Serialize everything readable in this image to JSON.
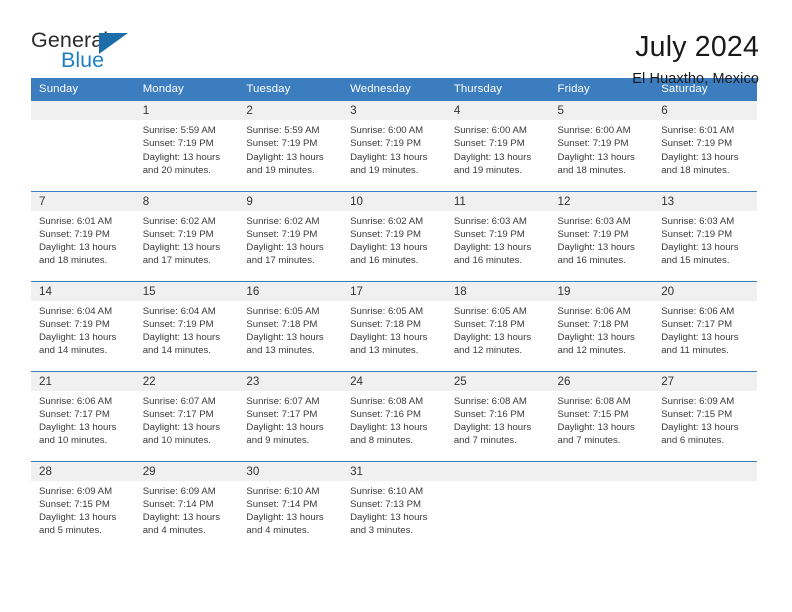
{
  "brand": {
    "word_one": "General",
    "word_two": "Blue",
    "flag_icon": "triangle-flag-icon"
  },
  "header": {
    "title": "July 2024",
    "subtitle": "El Huaxtho, Mexico"
  },
  "colors": {
    "header_blue": "#3b7dbf",
    "brand_blue": "#1f7fc4",
    "flag_blue": "#1b6ea8",
    "daynum_band": "#f0f0f0",
    "text": "#1a1a1a"
  },
  "calendar": {
    "weekdays": [
      "Sunday",
      "Monday",
      "Tuesday",
      "Wednesday",
      "Thursday",
      "Friday",
      "Saturday"
    ],
    "weeks": [
      [
        {
          "day": "",
          "blank": true,
          "sunrise": "",
          "sunset": "",
          "daylight_1": "",
          "daylight_2": ""
        },
        {
          "day": "1",
          "sunrise": "Sunrise: 5:59 AM",
          "sunset": "Sunset: 7:19 PM",
          "daylight_1": "Daylight: 13 hours",
          "daylight_2": "and 20 minutes."
        },
        {
          "day": "2",
          "sunrise": "Sunrise: 5:59 AM",
          "sunset": "Sunset: 7:19 PM",
          "daylight_1": "Daylight: 13 hours",
          "daylight_2": "and 19 minutes."
        },
        {
          "day": "3",
          "sunrise": "Sunrise: 6:00 AM",
          "sunset": "Sunset: 7:19 PM",
          "daylight_1": "Daylight: 13 hours",
          "daylight_2": "and 19 minutes."
        },
        {
          "day": "4",
          "sunrise": "Sunrise: 6:00 AM",
          "sunset": "Sunset: 7:19 PM",
          "daylight_1": "Daylight: 13 hours",
          "daylight_2": "and 19 minutes."
        },
        {
          "day": "5",
          "sunrise": "Sunrise: 6:00 AM",
          "sunset": "Sunset: 7:19 PM",
          "daylight_1": "Daylight: 13 hours",
          "daylight_2": "and 18 minutes."
        },
        {
          "day": "6",
          "sunrise": "Sunrise: 6:01 AM",
          "sunset": "Sunset: 7:19 PM",
          "daylight_1": "Daylight: 13 hours",
          "daylight_2": "and 18 minutes."
        }
      ],
      [
        {
          "day": "7",
          "sunrise": "Sunrise: 6:01 AM",
          "sunset": "Sunset: 7:19 PM",
          "daylight_1": "Daylight: 13 hours",
          "daylight_2": "and 18 minutes."
        },
        {
          "day": "8",
          "sunrise": "Sunrise: 6:02 AM",
          "sunset": "Sunset: 7:19 PM",
          "daylight_1": "Daylight: 13 hours",
          "daylight_2": "and 17 minutes."
        },
        {
          "day": "9",
          "sunrise": "Sunrise: 6:02 AM",
          "sunset": "Sunset: 7:19 PM",
          "daylight_1": "Daylight: 13 hours",
          "daylight_2": "and 17 minutes."
        },
        {
          "day": "10",
          "sunrise": "Sunrise: 6:02 AM",
          "sunset": "Sunset: 7:19 PM",
          "daylight_1": "Daylight: 13 hours",
          "daylight_2": "and 16 minutes."
        },
        {
          "day": "11",
          "sunrise": "Sunrise: 6:03 AM",
          "sunset": "Sunset: 7:19 PM",
          "daylight_1": "Daylight: 13 hours",
          "daylight_2": "and 16 minutes."
        },
        {
          "day": "12",
          "sunrise": "Sunrise: 6:03 AM",
          "sunset": "Sunset: 7:19 PM",
          "daylight_1": "Daylight: 13 hours",
          "daylight_2": "and 16 minutes."
        },
        {
          "day": "13",
          "sunrise": "Sunrise: 6:03 AM",
          "sunset": "Sunset: 7:19 PM",
          "daylight_1": "Daylight: 13 hours",
          "daylight_2": "and 15 minutes."
        }
      ],
      [
        {
          "day": "14",
          "sunrise": "Sunrise: 6:04 AM",
          "sunset": "Sunset: 7:19 PM",
          "daylight_1": "Daylight: 13 hours",
          "daylight_2": "and 14 minutes."
        },
        {
          "day": "15",
          "sunrise": "Sunrise: 6:04 AM",
          "sunset": "Sunset: 7:19 PM",
          "daylight_1": "Daylight: 13 hours",
          "daylight_2": "and 14 minutes."
        },
        {
          "day": "16",
          "sunrise": "Sunrise: 6:05 AM",
          "sunset": "Sunset: 7:18 PM",
          "daylight_1": "Daylight: 13 hours",
          "daylight_2": "and 13 minutes."
        },
        {
          "day": "17",
          "sunrise": "Sunrise: 6:05 AM",
          "sunset": "Sunset: 7:18 PM",
          "daylight_1": "Daylight: 13 hours",
          "daylight_2": "and 13 minutes."
        },
        {
          "day": "18",
          "sunrise": "Sunrise: 6:05 AM",
          "sunset": "Sunset: 7:18 PM",
          "daylight_1": "Daylight: 13 hours",
          "daylight_2": "and 12 minutes."
        },
        {
          "day": "19",
          "sunrise": "Sunrise: 6:06 AM",
          "sunset": "Sunset: 7:18 PM",
          "daylight_1": "Daylight: 13 hours",
          "daylight_2": "and 12 minutes."
        },
        {
          "day": "20",
          "sunrise": "Sunrise: 6:06 AM",
          "sunset": "Sunset: 7:17 PM",
          "daylight_1": "Daylight: 13 hours",
          "daylight_2": "and 11 minutes."
        }
      ],
      [
        {
          "day": "21",
          "sunrise": "Sunrise: 6:06 AM",
          "sunset": "Sunset: 7:17 PM",
          "daylight_1": "Daylight: 13 hours",
          "daylight_2": "and 10 minutes."
        },
        {
          "day": "22",
          "sunrise": "Sunrise: 6:07 AM",
          "sunset": "Sunset: 7:17 PM",
          "daylight_1": "Daylight: 13 hours",
          "daylight_2": "and 10 minutes."
        },
        {
          "day": "23",
          "sunrise": "Sunrise: 6:07 AM",
          "sunset": "Sunset: 7:17 PM",
          "daylight_1": "Daylight: 13 hours",
          "daylight_2": "and 9 minutes."
        },
        {
          "day": "24",
          "sunrise": "Sunrise: 6:08 AM",
          "sunset": "Sunset: 7:16 PM",
          "daylight_1": "Daylight: 13 hours",
          "daylight_2": "and 8 minutes."
        },
        {
          "day": "25",
          "sunrise": "Sunrise: 6:08 AM",
          "sunset": "Sunset: 7:16 PM",
          "daylight_1": "Daylight: 13 hours",
          "daylight_2": "and 7 minutes."
        },
        {
          "day": "26",
          "sunrise": "Sunrise: 6:08 AM",
          "sunset": "Sunset: 7:15 PM",
          "daylight_1": "Daylight: 13 hours",
          "daylight_2": "and 7 minutes."
        },
        {
          "day": "27",
          "sunrise": "Sunrise: 6:09 AM",
          "sunset": "Sunset: 7:15 PM",
          "daylight_1": "Daylight: 13 hours",
          "daylight_2": "and 6 minutes."
        }
      ],
      [
        {
          "day": "28",
          "sunrise": "Sunrise: 6:09 AM",
          "sunset": "Sunset: 7:15 PM",
          "daylight_1": "Daylight: 13 hours",
          "daylight_2": "and 5 minutes."
        },
        {
          "day": "29",
          "sunrise": "Sunrise: 6:09 AM",
          "sunset": "Sunset: 7:14 PM",
          "daylight_1": "Daylight: 13 hours",
          "daylight_2": "and 4 minutes."
        },
        {
          "day": "30",
          "sunrise": "Sunrise: 6:10 AM",
          "sunset": "Sunset: 7:14 PM",
          "daylight_1": "Daylight: 13 hours",
          "daylight_2": "and 4 minutes."
        },
        {
          "day": "31",
          "sunrise": "Sunrise: 6:10 AM",
          "sunset": "Sunset: 7:13 PM",
          "daylight_1": "Daylight: 13 hours",
          "daylight_2": "and 3 minutes."
        },
        {
          "day": "",
          "blank": true,
          "sunrise": "",
          "sunset": "",
          "daylight_1": "",
          "daylight_2": ""
        },
        {
          "day": "",
          "blank": true,
          "sunrise": "",
          "sunset": "",
          "daylight_1": "",
          "daylight_2": ""
        },
        {
          "day": "",
          "blank": true,
          "sunrise": "",
          "sunset": "",
          "daylight_1": "",
          "daylight_2": ""
        }
      ]
    ]
  }
}
